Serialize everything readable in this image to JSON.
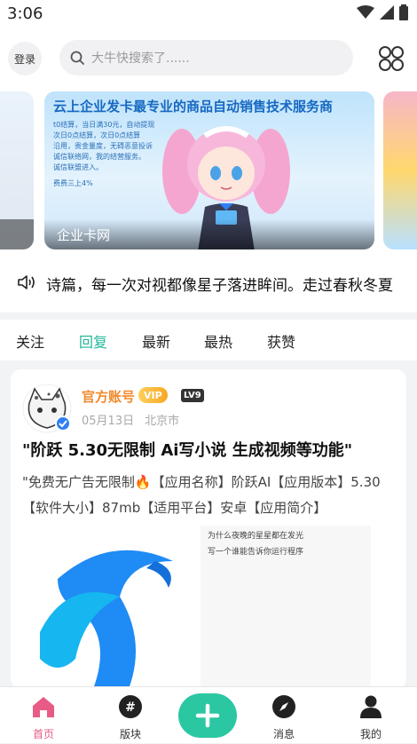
{
  "status_bar": {
    "time": "3:06"
  },
  "header": {
    "login_label": "登录",
    "search_placeholder": "大牛快搜索了......"
  },
  "banner": {
    "title": "云上企业发卡最专业的商品自动销售技术服务商",
    "features": [
      "t0结算，当日满30元，自动提现",
      "次日0点结算，次日0点结算",
      "沿用，贵金量度，无碍恶意投诉",
      "诚信联络网，我的结营服务。",
      "诚信联盟进入。"
    ],
    "fee_text": "费费三上4%",
    "caption": "企业卡网"
  },
  "notice": {
    "text": "诗篇，每一次对视都像星子落进眸间。走过春秋冬夏"
  },
  "tabs": [
    {
      "label": "关注",
      "active": false
    },
    {
      "label": "回复",
      "active": true
    },
    {
      "label": "最新",
      "active": false
    },
    {
      "label": "最热",
      "active": false
    },
    {
      "label": "获赞",
      "active": false
    }
  ],
  "post": {
    "author": "官方账号",
    "vip": "VIP",
    "level": "LV9",
    "date": "05月13日",
    "location": "北京市",
    "title": "\"阶跃 5.30无限制 Ai写小说 生成视频等功能\"",
    "body": "\"免费无广告无限制🔥【应用名称】阶跃AI【应用版本】5.30【软件大小】87mb【适用平台】安卓【应用简介】",
    "image2_lines": [
      "为什么夜晚的星星都在发光",
      "写一个谁能告诉你运行程序"
    ]
  },
  "bottom_nav": [
    {
      "label": "首页",
      "icon": "home-icon",
      "active": true
    },
    {
      "label": "版块",
      "icon": "hashtag-icon",
      "active": false
    },
    {
      "label": "消息",
      "icon": "compass-icon",
      "active": false
    },
    {
      "label": "我的",
      "icon": "user-icon",
      "active": false
    }
  ],
  "colors": {
    "accent": "#21b89a",
    "nav_active": "#e75b86",
    "author": "#f08a2c",
    "publish": "#2bc7a3"
  }
}
